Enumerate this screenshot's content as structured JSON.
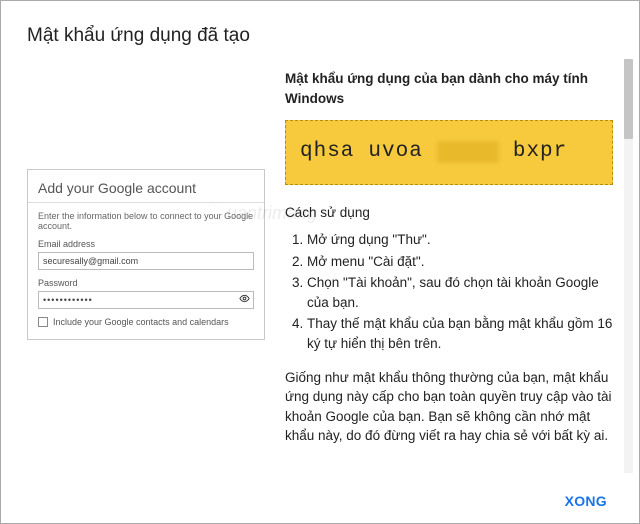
{
  "title": "Mật khẩu ứng dụng đã tạo",
  "subhead": "Mật khẩu ứng dụng của bạn dành cho máy tính Windows",
  "app_password": {
    "p1": "qhsa",
    "p2": "uvoa",
    "p4": "bxpr"
  },
  "howto_title": "Cách sử dụng",
  "steps": [
    "Mở ứng dụng \"Thư\".",
    "Mở menu \"Cài đặt\".",
    "Chọn \"Tài khoản\", sau đó chọn tài khoản Google của bạn.",
    "Thay thế mật khẩu của bạn bằng mật khẩu gồm 16 ký tự hiển thị bên trên."
  ],
  "paragraph": "Giống như mật khẩu thông thường của bạn, mật khẩu ứng dụng này cấp cho bạn toàn quyền truy cập vào tài khoản Google của bạn. Bạn sẽ không cần nhớ mật khẩu này, do đó đừng viết ra hay chia sẻ với bất kỳ ai.",
  "done_label": "XONG",
  "account_box": {
    "title": "Add your Google account",
    "info": "Enter the information below to connect to your Google account.",
    "email_label": "Email address",
    "email_value": "securesally@gmail.com",
    "password_label": "Password",
    "password_value": "••••••••••••",
    "include_label": "Include your Google contacts and calendars"
  },
  "watermark": "uantrimang"
}
